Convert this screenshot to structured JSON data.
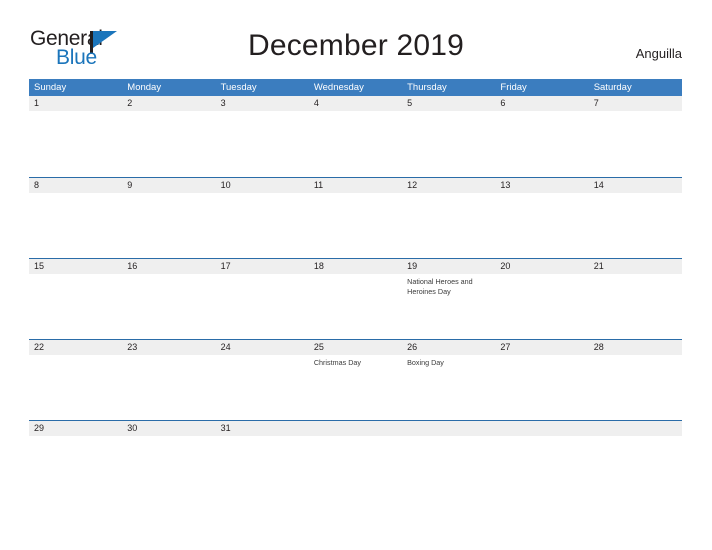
{
  "brand": {
    "name_part1": "General",
    "name_part2": "Blue",
    "primary_color": "#1b75bb"
  },
  "header": {
    "title": "December 2019",
    "country": "Anguilla"
  },
  "calendar": {
    "header_color": "#3b7dbf",
    "band_color": "#efefef",
    "rule_color": "#2a6ca8",
    "weekdays": [
      "Sunday",
      "Monday",
      "Tuesday",
      "Wednesday",
      "Thursday",
      "Friday",
      "Saturday"
    ],
    "weeks": [
      {
        "days": [
          {
            "date": "1",
            "event": ""
          },
          {
            "date": "2",
            "event": ""
          },
          {
            "date": "3",
            "event": ""
          },
          {
            "date": "4",
            "event": ""
          },
          {
            "date": "5",
            "event": ""
          },
          {
            "date": "6",
            "event": ""
          },
          {
            "date": "7",
            "event": ""
          }
        ]
      },
      {
        "days": [
          {
            "date": "8",
            "event": ""
          },
          {
            "date": "9",
            "event": ""
          },
          {
            "date": "10",
            "event": ""
          },
          {
            "date": "11",
            "event": ""
          },
          {
            "date": "12",
            "event": ""
          },
          {
            "date": "13",
            "event": ""
          },
          {
            "date": "14",
            "event": ""
          }
        ]
      },
      {
        "days": [
          {
            "date": "15",
            "event": ""
          },
          {
            "date": "16",
            "event": ""
          },
          {
            "date": "17",
            "event": ""
          },
          {
            "date": "18",
            "event": ""
          },
          {
            "date": "19",
            "event": "National Heroes and Heroines Day"
          },
          {
            "date": "20",
            "event": ""
          },
          {
            "date": "21",
            "event": ""
          }
        ]
      },
      {
        "days": [
          {
            "date": "22",
            "event": ""
          },
          {
            "date": "23",
            "event": ""
          },
          {
            "date": "24",
            "event": ""
          },
          {
            "date": "25",
            "event": "Christmas Day"
          },
          {
            "date": "26",
            "event": "Boxing Day"
          },
          {
            "date": "27",
            "event": ""
          },
          {
            "date": "28",
            "event": ""
          }
        ]
      },
      {
        "days": [
          {
            "date": "29",
            "event": ""
          },
          {
            "date": "30",
            "event": ""
          },
          {
            "date": "31",
            "event": ""
          },
          {
            "date": "",
            "event": ""
          },
          {
            "date": "",
            "event": ""
          },
          {
            "date": "",
            "event": ""
          },
          {
            "date": "",
            "event": ""
          }
        ]
      }
    ]
  }
}
